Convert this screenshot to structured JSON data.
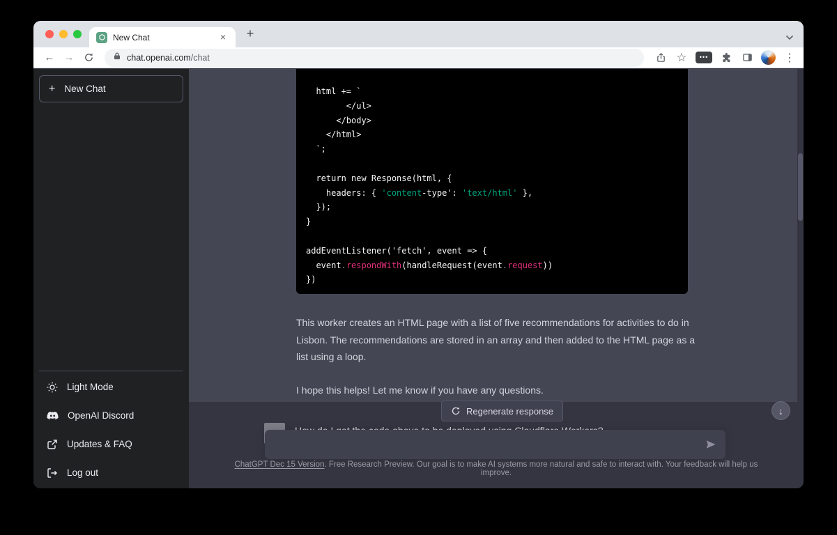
{
  "browser": {
    "tab_title": "New Chat",
    "close_label": "×",
    "new_tab_label": "+",
    "url_host": "chat.openai.com",
    "url_path": "/chat",
    "back_arrow": "←",
    "forward_arrow": "→",
    "star": "☆",
    "extension_dots": "•••",
    "menu_dots": "⋮"
  },
  "sidebar": {
    "plus": "+",
    "new_chat_label": "New Chat",
    "items": [
      {
        "label": "Light Mode"
      },
      {
        "label": "OpenAI Discord"
      },
      {
        "label": "Updates & FAQ"
      },
      {
        "label": "Log out"
      }
    ]
  },
  "chat": {
    "code_block": {
      "lines": [
        [
          {
            "t": "  html += `"
          }
        ],
        [
          {
            "t": "        </ul>"
          }
        ],
        [
          {
            "t": "      </body>"
          }
        ],
        [
          {
            "t": "    </html>"
          }
        ],
        [
          {
            "t": "  `;"
          }
        ],
        [],
        [
          {
            "t": "  return new Response(html, {"
          }
        ],
        [
          {
            "t": "    headers: { "
          },
          {
            "t": "'content",
            "c": "str"
          },
          {
            "t": "-type': "
          },
          {
            "t": "'text/html'",
            "c": "str"
          },
          {
            "t": " },"
          }
        ],
        [
          {
            "t": "  });"
          }
        ],
        [
          {
            "t": "}"
          }
        ],
        [],
        [
          {
            "t": "addEventListener('fetch', event => {"
          }
        ],
        [
          {
            "t": "  event"
          },
          {
            "t": ".",
            "c": "dim"
          },
          {
            "t": "respondWith",
            "c": "pink"
          },
          {
            "t": "(handleRequest(event"
          },
          {
            "t": ".",
            "c": "dim"
          },
          {
            "t": "request",
            "c": "pink"
          },
          {
            "t": "))"
          }
        ],
        [
          {
            "t": "})"
          }
        ]
      ]
    },
    "paragraphs": [
      "This worker creates an HTML page with a list of five recommendations for activities to do in Lisbon. The recommendations are stored in an array and then added to the HTML page as a list using a loop.",
      "I hope this helps! Let me know if you have any questions."
    ],
    "regenerate_label": "Regenerate response",
    "clipped_user_message": "How do I get the code above to be deployed using Cloudflare Workers?",
    "composer": {
      "value": ""
    },
    "scroll_down_arrow": "↓",
    "footer_link": "ChatGPT Dec 15 Version",
    "footer_text": ". Free Research Preview. Our goal is to make AI systems more natural and safe to interact with. Your feedback will help us improve."
  },
  "colors": {
    "sidebar_bg": "#202123",
    "chat_bg": "#343541",
    "assistant_bubble_bg": "#444654",
    "code_bg": "#000000",
    "code_string_green": "#00a67d",
    "code_property_pink": "#df3079",
    "input_bg": "#40414f",
    "favicon_green": "#5ba183",
    "traffic_red": "#ff5f57",
    "traffic_yellow": "#febc2e",
    "traffic_green": "#28c840"
  }
}
